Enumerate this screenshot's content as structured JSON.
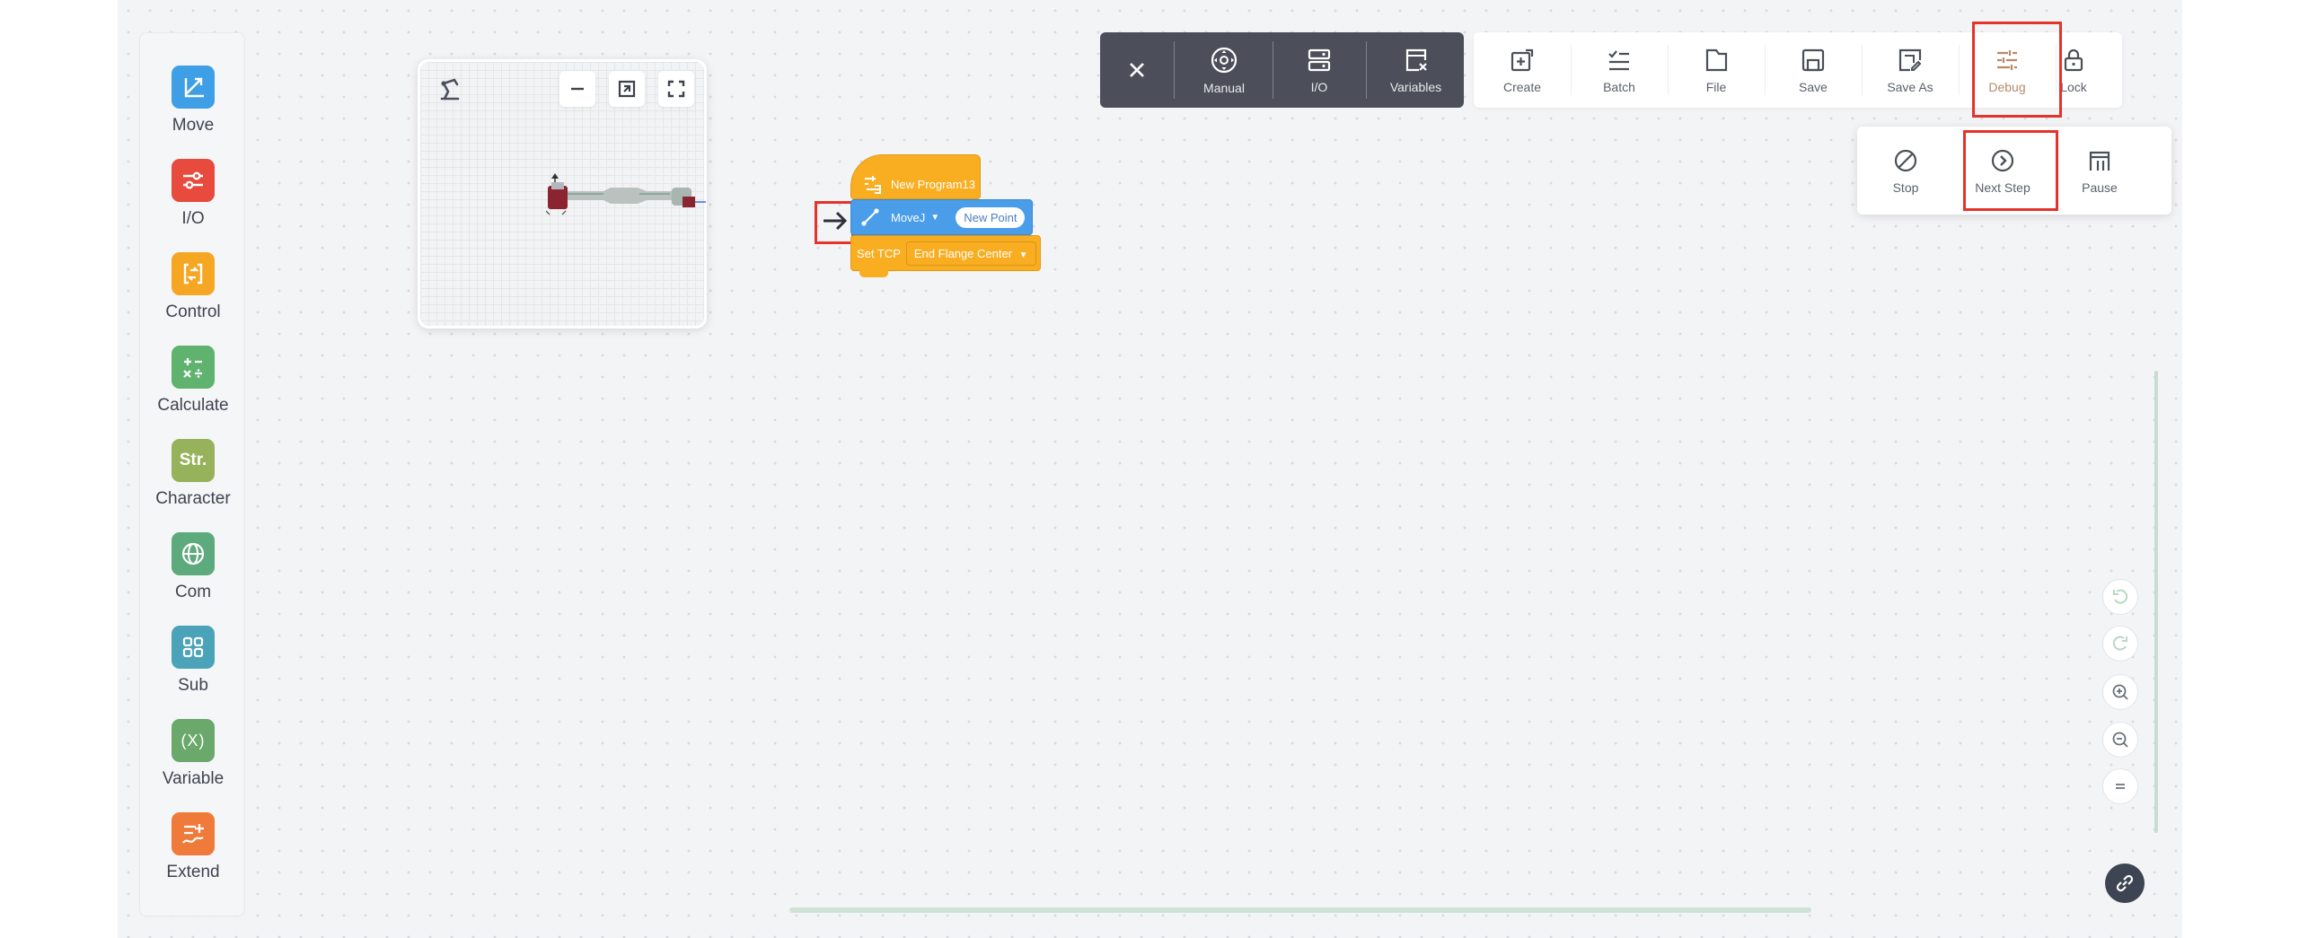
{
  "palette": {
    "items": [
      {
        "label": "Move",
        "icon": "move-icon",
        "color": "#3f9fe6"
      },
      {
        "label": "I/O",
        "icon": "io-icon",
        "color": "#e94a3e"
      },
      {
        "label": "Control",
        "icon": "control-icon",
        "color": "#f5a623"
      },
      {
        "label": "Calculate",
        "icon": "calculate-icon",
        "color": "#5fb36e"
      },
      {
        "label": "Character",
        "icon": "character-icon",
        "color": "#96b25a",
        "glyph": "Str."
      },
      {
        "label": "Com",
        "icon": "globe-icon",
        "color": "#5daa7d"
      },
      {
        "label": "Sub",
        "icon": "grid-icon",
        "color": "#4aa3b8"
      },
      {
        "label": "Variable",
        "icon": "variable-icon",
        "color": "#6aa86b",
        "glyph": "(X)"
      },
      {
        "label": "Extend",
        "icon": "extend-icon",
        "color": "#f07a3a"
      }
    ]
  },
  "dark_toolbar": {
    "close": "close-icon",
    "items": [
      {
        "label": "Manual",
        "icon": "joystick-icon"
      },
      {
        "label": "I/O",
        "icon": "io-panel-icon"
      },
      {
        "label": "Variables",
        "icon": "variables-icon"
      }
    ]
  },
  "toolbar": {
    "items": [
      {
        "label": "Create",
        "icon": "create-icon"
      },
      {
        "label": "Batch",
        "icon": "batch-icon"
      },
      {
        "label": "File",
        "icon": "file-icon"
      },
      {
        "label": "Save",
        "icon": "save-icon"
      },
      {
        "label": "Save As",
        "icon": "save-as-icon"
      },
      {
        "label": "Debug",
        "icon": "debug-icon",
        "active_color": "#b5896a"
      },
      {
        "label": "Lock",
        "icon": "lock-icon"
      }
    ]
  },
  "debug_menu": {
    "items": [
      {
        "label": "Stop",
        "icon": "stop-icon"
      },
      {
        "label": "Next Step",
        "icon": "next-step-icon"
      },
      {
        "label": "Pause",
        "icon": "pause-icon"
      }
    ]
  },
  "blocks": {
    "program_name": "New Program13",
    "move_type": "MoveJ",
    "point_name": "New Point",
    "set_tcp_label": "Set TCP",
    "tcp_value": "End Flange Center"
  },
  "colors": {
    "highlight": "#e5332a",
    "block_orange": "#f9ae22",
    "block_blue": "#4a9de8"
  }
}
